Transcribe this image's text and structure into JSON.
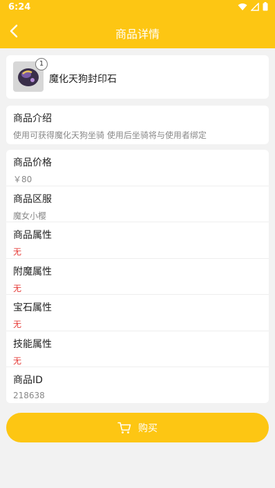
{
  "status_bar": {
    "time": "6:24"
  },
  "header": {
    "title": "商品详情"
  },
  "item": {
    "name": "魔化天狗封印石",
    "quantity": "1"
  },
  "intro": {
    "label": "商品介绍",
    "text": "使用可获得魔化天狗坐骑 使用后坐骑将与使用者绑定"
  },
  "details": [
    {
      "label": "商品价格",
      "value": "￥80"
    },
    {
      "label": "商品区服",
      "value": "魔女小樱"
    },
    {
      "label": "商品属性",
      "value": "无"
    },
    {
      "label": "附魔属性",
      "value": "无"
    },
    {
      "label": "宝石属性",
      "value": "无"
    },
    {
      "label": "技能属性",
      "value": "无"
    },
    {
      "label": "商品ID",
      "value": "218638"
    }
  ],
  "buy_button": {
    "label": "购买"
  },
  "colors": {
    "accent": "#fdc613",
    "none_value": "#e53935"
  }
}
